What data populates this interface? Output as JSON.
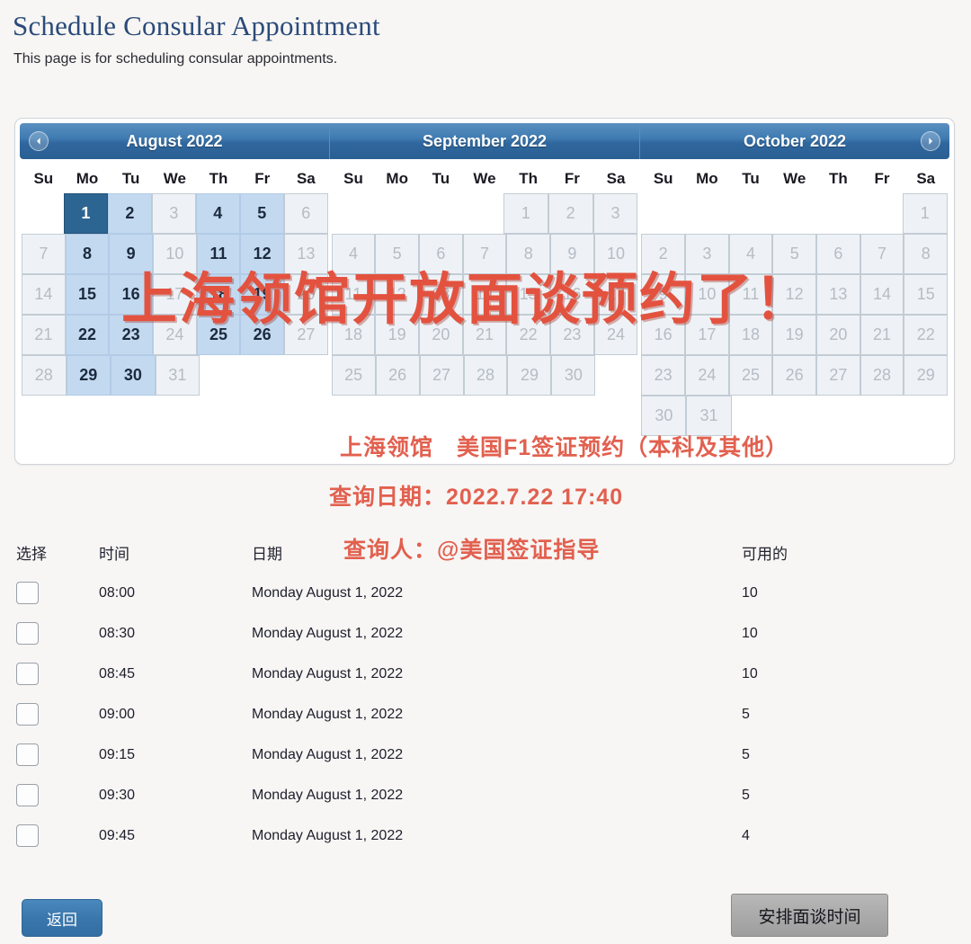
{
  "header": {
    "title": "Schedule Consular Appointment",
    "subtitle": "This page is for scheduling consular appointments."
  },
  "calendar": {
    "prev_icon": "chevron-left-icon",
    "next_icon": "chevron-right-icon",
    "weekday_labels": [
      "Su",
      "Mo",
      "Tu",
      "We",
      "Th",
      "Fr",
      "Sa"
    ],
    "months": [
      {
        "title": "August 2022",
        "lead_blank": 1,
        "days": [
          {
            "n": "1",
            "state": "sel"
          },
          {
            "n": "2",
            "state": "on"
          },
          {
            "n": "3",
            "state": "off"
          },
          {
            "n": "4",
            "state": "on"
          },
          {
            "n": "5",
            "state": "on"
          },
          {
            "n": "6",
            "state": "off"
          },
          {
            "n": "7",
            "state": "off"
          },
          {
            "n": "8",
            "state": "on"
          },
          {
            "n": "9",
            "state": "on"
          },
          {
            "n": "10",
            "state": "off"
          },
          {
            "n": "11",
            "state": "on"
          },
          {
            "n": "12",
            "state": "on"
          },
          {
            "n": "13",
            "state": "off"
          },
          {
            "n": "14",
            "state": "off"
          },
          {
            "n": "15",
            "state": "on"
          },
          {
            "n": "16",
            "state": "on"
          },
          {
            "n": "17",
            "state": "off"
          },
          {
            "n": "18",
            "state": "on"
          },
          {
            "n": "19",
            "state": "on"
          },
          {
            "n": "20",
            "state": "off"
          },
          {
            "n": "21",
            "state": "off"
          },
          {
            "n": "22",
            "state": "on"
          },
          {
            "n": "23",
            "state": "on"
          },
          {
            "n": "24",
            "state": "off"
          },
          {
            "n": "25",
            "state": "on"
          },
          {
            "n": "26",
            "state": "on"
          },
          {
            "n": "27",
            "state": "off"
          },
          {
            "n": "28",
            "state": "off"
          },
          {
            "n": "29",
            "state": "on"
          },
          {
            "n": "30",
            "state": "on"
          },
          {
            "n": "31",
            "state": "off"
          }
        ]
      },
      {
        "title": "September 2022",
        "lead_blank": 4,
        "days": [
          {
            "n": "1",
            "state": "off"
          },
          {
            "n": "2",
            "state": "off"
          },
          {
            "n": "3",
            "state": "off"
          },
          {
            "n": "4",
            "state": "off"
          },
          {
            "n": "5",
            "state": "off"
          },
          {
            "n": "6",
            "state": "off"
          },
          {
            "n": "7",
            "state": "off"
          },
          {
            "n": "8",
            "state": "off"
          },
          {
            "n": "9",
            "state": "off"
          },
          {
            "n": "10",
            "state": "off"
          },
          {
            "n": "11",
            "state": "off"
          },
          {
            "n": "12",
            "state": "off"
          },
          {
            "n": "13",
            "state": "off"
          },
          {
            "n": "14",
            "state": "off"
          },
          {
            "n": "15",
            "state": "off"
          },
          {
            "n": "16",
            "state": "off"
          },
          {
            "n": "17",
            "state": "off"
          },
          {
            "n": "18",
            "state": "off"
          },
          {
            "n": "19",
            "state": "off"
          },
          {
            "n": "20",
            "state": "off"
          },
          {
            "n": "21",
            "state": "off"
          },
          {
            "n": "22",
            "state": "off"
          },
          {
            "n": "23",
            "state": "off"
          },
          {
            "n": "24",
            "state": "off"
          },
          {
            "n": "25",
            "state": "off"
          },
          {
            "n": "26",
            "state": "off"
          },
          {
            "n": "27",
            "state": "off"
          },
          {
            "n": "28",
            "state": "off"
          },
          {
            "n": "29",
            "state": "off"
          },
          {
            "n": "30",
            "state": "off"
          }
        ]
      },
      {
        "title": "October 2022",
        "lead_blank": 6,
        "days": [
          {
            "n": "1",
            "state": "off"
          },
          {
            "n": "2",
            "state": "off"
          },
          {
            "n": "3",
            "state": "off"
          },
          {
            "n": "4",
            "state": "off"
          },
          {
            "n": "5",
            "state": "off"
          },
          {
            "n": "6",
            "state": "off"
          },
          {
            "n": "7",
            "state": "off"
          },
          {
            "n": "8",
            "state": "off"
          },
          {
            "n": "9",
            "state": "off"
          },
          {
            "n": "10",
            "state": "off"
          },
          {
            "n": "11",
            "state": "off"
          },
          {
            "n": "12",
            "state": "off"
          },
          {
            "n": "13",
            "state": "off"
          },
          {
            "n": "14",
            "state": "off"
          },
          {
            "n": "15",
            "state": "off"
          },
          {
            "n": "16",
            "state": "off"
          },
          {
            "n": "17",
            "state": "off"
          },
          {
            "n": "18",
            "state": "off"
          },
          {
            "n": "19",
            "state": "off"
          },
          {
            "n": "20",
            "state": "off"
          },
          {
            "n": "21",
            "state": "off"
          },
          {
            "n": "22",
            "state": "off"
          },
          {
            "n": "23",
            "state": "off"
          },
          {
            "n": "24",
            "state": "off"
          },
          {
            "n": "25",
            "state": "off"
          },
          {
            "n": "26",
            "state": "off"
          },
          {
            "n": "27",
            "state": "off"
          },
          {
            "n": "28",
            "state": "off"
          },
          {
            "n": "29",
            "state": "off"
          },
          {
            "n": "30",
            "state": "off"
          },
          {
            "n": "31",
            "state": "off"
          }
        ]
      }
    ]
  },
  "annotations": {
    "watermark": "上海领馆开放面谈预约了！",
    "consulate_line": "上海领馆　美国F1签证预约（本科及其他）",
    "query_date_line": "查询日期：2022.7.22  17:40",
    "querier_line": "查询人：@美国签证指导",
    "color": "#e2604f"
  },
  "slots": {
    "columns": [
      "选择",
      "时间",
      "日期",
      "可用的"
    ],
    "rows": [
      {
        "time": "08:00",
        "date": "Monday August 1, 2022",
        "available": "10",
        "checked": false
      },
      {
        "time": "08:30",
        "date": "Monday August 1, 2022",
        "available": "10",
        "checked": false
      },
      {
        "time": "08:45",
        "date": "Monday August 1, 2022",
        "available": "10",
        "checked": false
      },
      {
        "time": "09:00",
        "date": "Monday August 1, 2022",
        "available": "5",
        "checked": false
      },
      {
        "time": "09:15",
        "date": "Monday August 1, 2022",
        "available": "5",
        "checked": false
      },
      {
        "time": "09:30",
        "date": "Monday August 1, 2022",
        "available": "5",
        "checked": false
      },
      {
        "time": "09:45",
        "date": "Monday August 1, 2022",
        "available": "4",
        "checked": false
      }
    ]
  },
  "buttons": {
    "back": "返回",
    "schedule": "安排面谈时间"
  }
}
